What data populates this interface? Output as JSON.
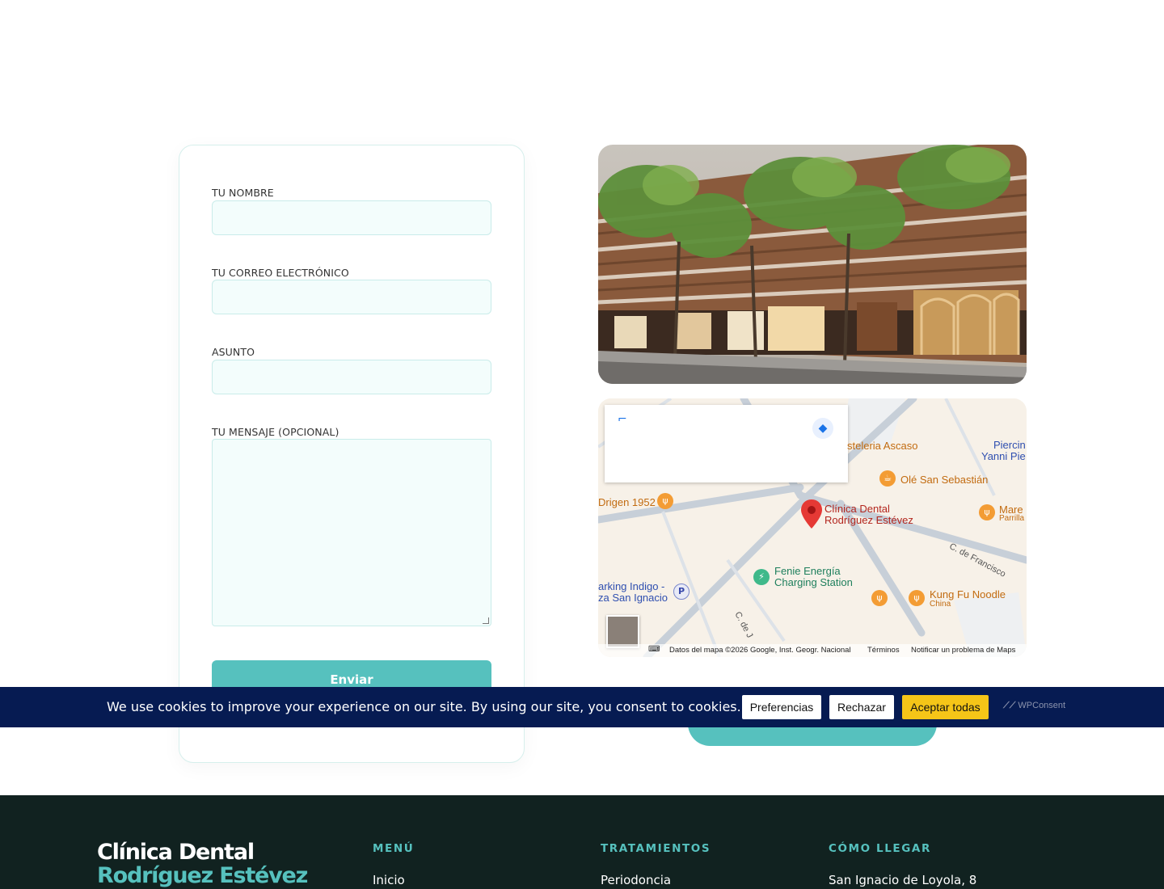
{
  "form": {
    "name_label": "TU NOMBRE",
    "email_label": "TU CORREO ELECTRÓNICO",
    "subject_label": "ASUNTO",
    "message_label": "TU MENSAJE (OPCIONAL)",
    "submit_label": "Enviar"
  },
  "map": {
    "places": {
      "pasteleria": "steleria Ascaso",
      "piercing_1": "Piercin",
      "piercing_2": "Yanni Pie",
      "ole": "Olé San Sebastián",
      "origen": "Drigen 1952",
      "clinic_1": "Clínica Dental",
      "clinic_2": "Rodríguez Estévez",
      "mare_1": "Mare",
      "mare_2": "Parrilla",
      "street": "C. de Francisco",
      "fenie_1": "Fenie Energía",
      "fenie_2": "Charging Station",
      "parking_1": "arking Indigo -",
      "parking_2": "za San Ignacio",
      "kungfu": "Kung Fu Noodle",
      "kungfu_sub": "China",
      "street2": "C. de J"
    },
    "attribution": "Datos del mapa ©2026 Google, Inst. Geogr. Nacional",
    "terms": "Términos",
    "report": "Notificar un problema de Maps"
  },
  "cookie": {
    "text": "We use cookies to improve your experience on our site. By using our site, you consent to cookies.",
    "preferences": "Preferencias",
    "reject": "Rechazar",
    "accept": "Aceptar todas",
    "brand": "WPConsent"
  },
  "footer": {
    "brand_line1": "Clínica Dental",
    "brand_line2": "Rodríguez Estévez",
    "menu_heading": "MENÚ",
    "menu_item": "Inicio",
    "treatments_heading": "TRATAMIENTOS",
    "treatments_item": "Periodoncia",
    "directions_heading": "CÓMO LLEGAR",
    "directions_item": "San Ignacio de Loyola, 8"
  },
  "colors": {
    "accent": "#56c1be",
    "banner": "#061b52",
    "footer": "#112220",
    "accept_button": "#f5c518"
  }
}
